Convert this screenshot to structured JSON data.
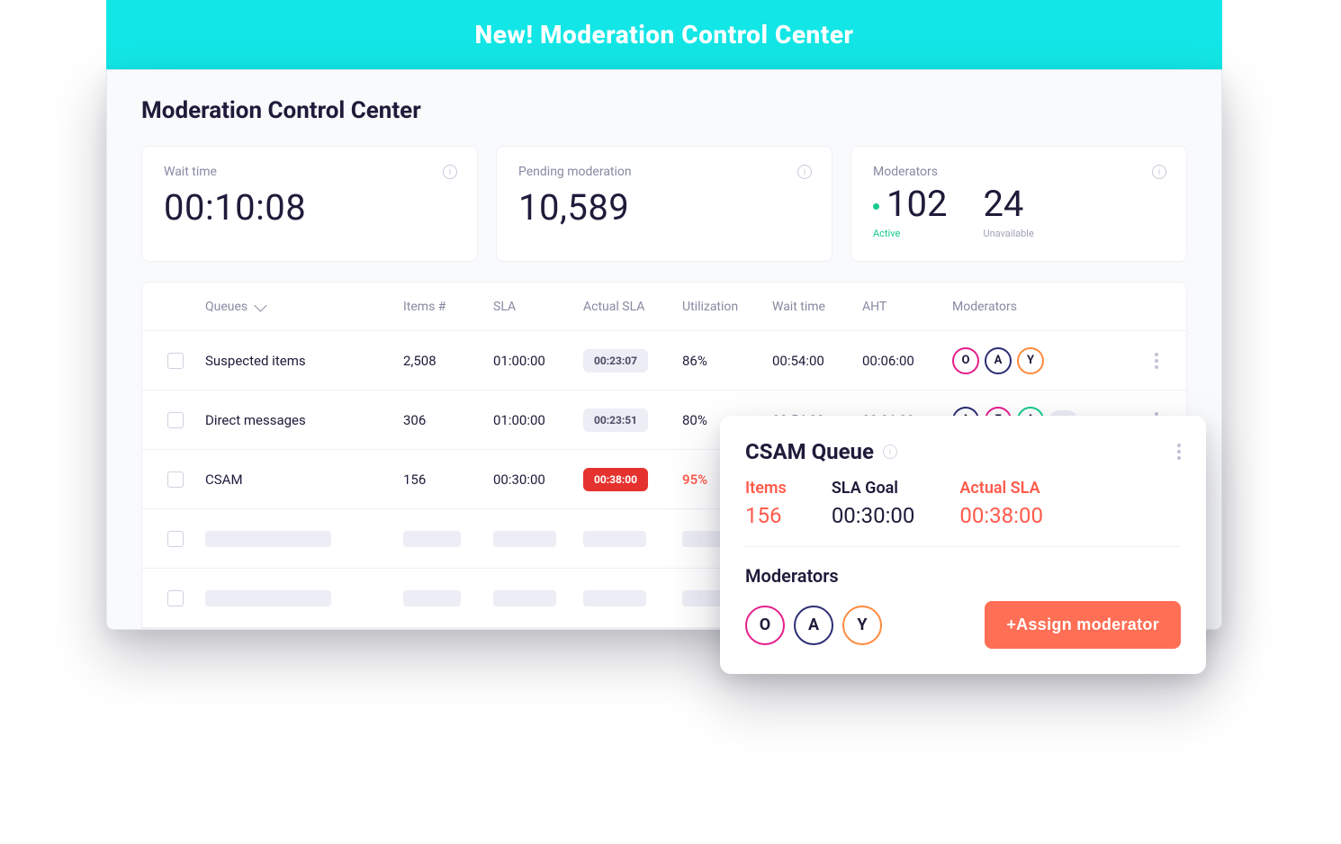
{
  "banner": {
    "title": "New! Moderation Control Center"
  },
  "pageTitle": "Moderation Control Center",
  "cards": {
    "waitTime": {
      "label": "Wait time",
      "value": "00:10:08"
    },
    "pending": {
      "label": "Pending moderation",
      "value": "10,589"
    },
    "moderators": {
      "label": "Moderators",
      "active": "102",
      "activeLabel": "Active",
      "unavailable": "24",
      "unavailableLabel": "Unavailable"
    }
  },
  "table": {
    "headers": {
      "queues": "Queues",
      "items": "Items #",
      "sla": "SLA",
      "actualSla": "Actual SLA",
      "utilization": "Utilization",
      "waitTime": "Wait time",
      "aht": "AHT",
      "moderators": "Moderators"
    },
    "rows": [
      {
        "name": "Suspected items",
        "items": "2,508",
        "sla": "01:00:00",
        "actualSla": "00:23:07",
        "actualSlaStatus": "neutral",
        "utilization": "86%",
        "utilAlert": false,
        "waitTime": "00:54:00",
        "aht": "00:06:00",
        "moderators": [
          {
            "letter": "O",
            "color": "pink"
          },
          {
            "letter": "A",
            "color": "navy"
          },
          {
            "letter": "Y",
            "color": "orange"
          }
        ],
        "more": null
      },
      {
        "name": "Direct messages",
        "items": "306",
        "sla": "01:00:00",
        "actualSla": "00:23:51",
        "actualSlaStatus": "neutral",
        "utilization": "80%",
        "utilAlert": false,
        "waitTime": "00:54:00",
        "aht": "00:06:00",
        "moderators": [
          {
            "letter": "A",
            "color": "navy"
          },
          {
            "letter": "F",
            "color": "pink"
          },
          {
            "letter": "A",
            "color": "teal"
          }
        ],
        "more": "+22"
      },
      {
        "name": "CSAM",
        "items": "156",
        "sla": "00:30:00",
        "actualSla": "00:38:00",
        "actualSlaStatus": "danger",
        "utilization": "95%",
        "utilAlert": true,
        "waitTime": "",
        "aht": "",
        "moderators": [],
        "more": null
      }
    ]
  },
  "popover": {
    "title": "CSAM Queue",
    "items": {
      "label": "Items",
      "value": "156",
      "alert": true
    },
    "slaGoal": {
      "label": "SLA Goal",
      "value": "00:30:00",
      "alert": false
    },
    "actualSla": {
      "label": "Actual SLA",
      "value": "00:38:00",
      "alert": true
    },
    "moderatorsLabel": "Moderators",
    "moderators": [
      {
        "letter": "O",
        "color": "pink"
      },
      {
        "letter": "A",
        "color": "navy"
      },
      {
        "letter": "Y",
        "color": "orange"
      }
    ],
    "assignBtn": "+Assign moderator"
  }
}
